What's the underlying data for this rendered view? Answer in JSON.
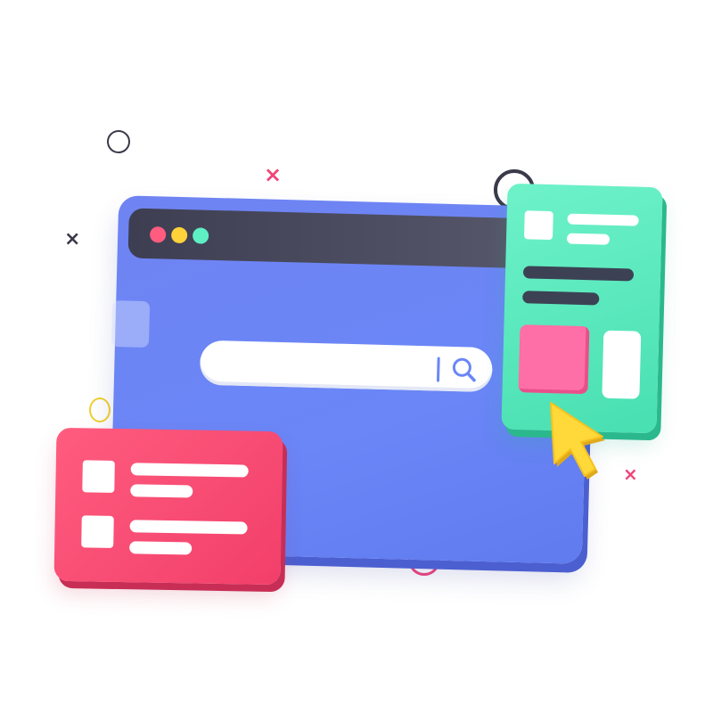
{
  "colors": {
    "browser_body": "#6a86f7",
    "titlebar": "#4a4a5e",
    "dot_red": "#ff5c7f",
    "dot_yellow": "#ffd23a",
    "dot_green": "#5ef0c4",
    "card_red": "#f5486f",
    "card_green": "#5cecc0",
    "pink_box": "#ff6fa7",
    "pointer": "#ffd83a"
  },
  "icons": {
    "search": "magnifier-icon",
    "pointer": "mouse-pointer-icon",
    "window_controls": [
      "close-dot",
      "minimize-dot",
      "maximize-dot"
    ]
  },
  "search": {
    "placeholder": ""
  }
}
